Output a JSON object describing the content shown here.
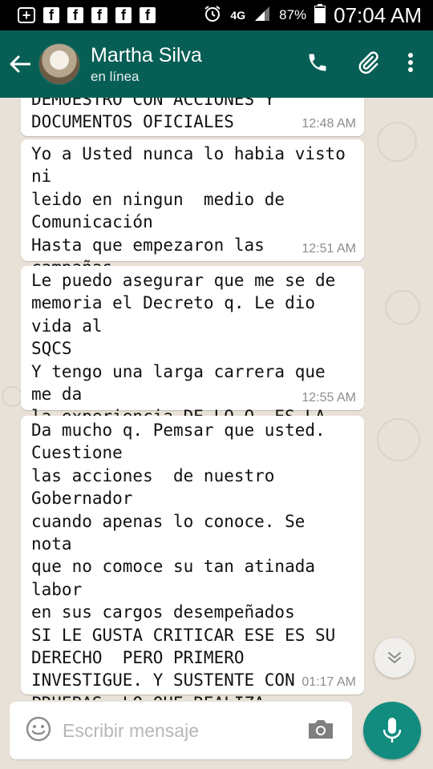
{
  "status_bar": {
    "notification_icons": [
      "plus-box-icon",
      "facebook-icon",
      "facebook-icon",
      "facebook-icon",
      "facebook-icon",
      "facebook-icon"
    ],
    "network": "4G",
    "battery_percent": "87%",
    "time": "07:04 AM"
  },
  "header": {
    "contact_name": "Martha Silva",
    "contact_status": "en línea"
  },
  "messages": [
    {
      "text": "DEMUESTRO CON ACCIONES Y\nDOCUMENTOS OFICIALES",
      "time": "12:48 AM"
    },
    {
      "text": "Yo a Usted nunca lo habia visto ni\nleido en ningun  medio de\nComunicación\nHasta que empezaron las campañas",
      "time": "12:51 AM"
    },
    {
      "text": "Le puedo asegurar que me se de\nmemoria el Decreto q. Le dio vida al\nSQCS\nY tengo una larga carrera que me da\nla experiencia DE LO Q. ES LA\nDEMOCRACIA",
      "time": "12:55 AM"
    },
    {
      "text": "Da mucho q. Pemsar que usted.\nCuestione\nlas acciones  de nuestro Gobernador\ncuando apenas lo conoce. Se nota\nque no comoce su tan atinada labor\nen sus cargos desempeñados\nSI LE GUSTA CRITICAR ESE ES SU\nDERECHO  PERO PRIMERO\nINVESTIGUE. Y SUSTENTE CON\nPRUEBAS. LO QUE REALIZA\nÚNICAMENTE EN LAS REDES",
      "time": "01:17 AM"
    }
  ],
  "composer": {
    "placeholder": "Escribir mensaje",
    "value": ""
  },
  "colors": {
    "header": "#075e54",
    "mic_button": "#128c7e",
    "bubble": "#ffffff",
    "chat_background": "#e8e1d7"
  }
}
